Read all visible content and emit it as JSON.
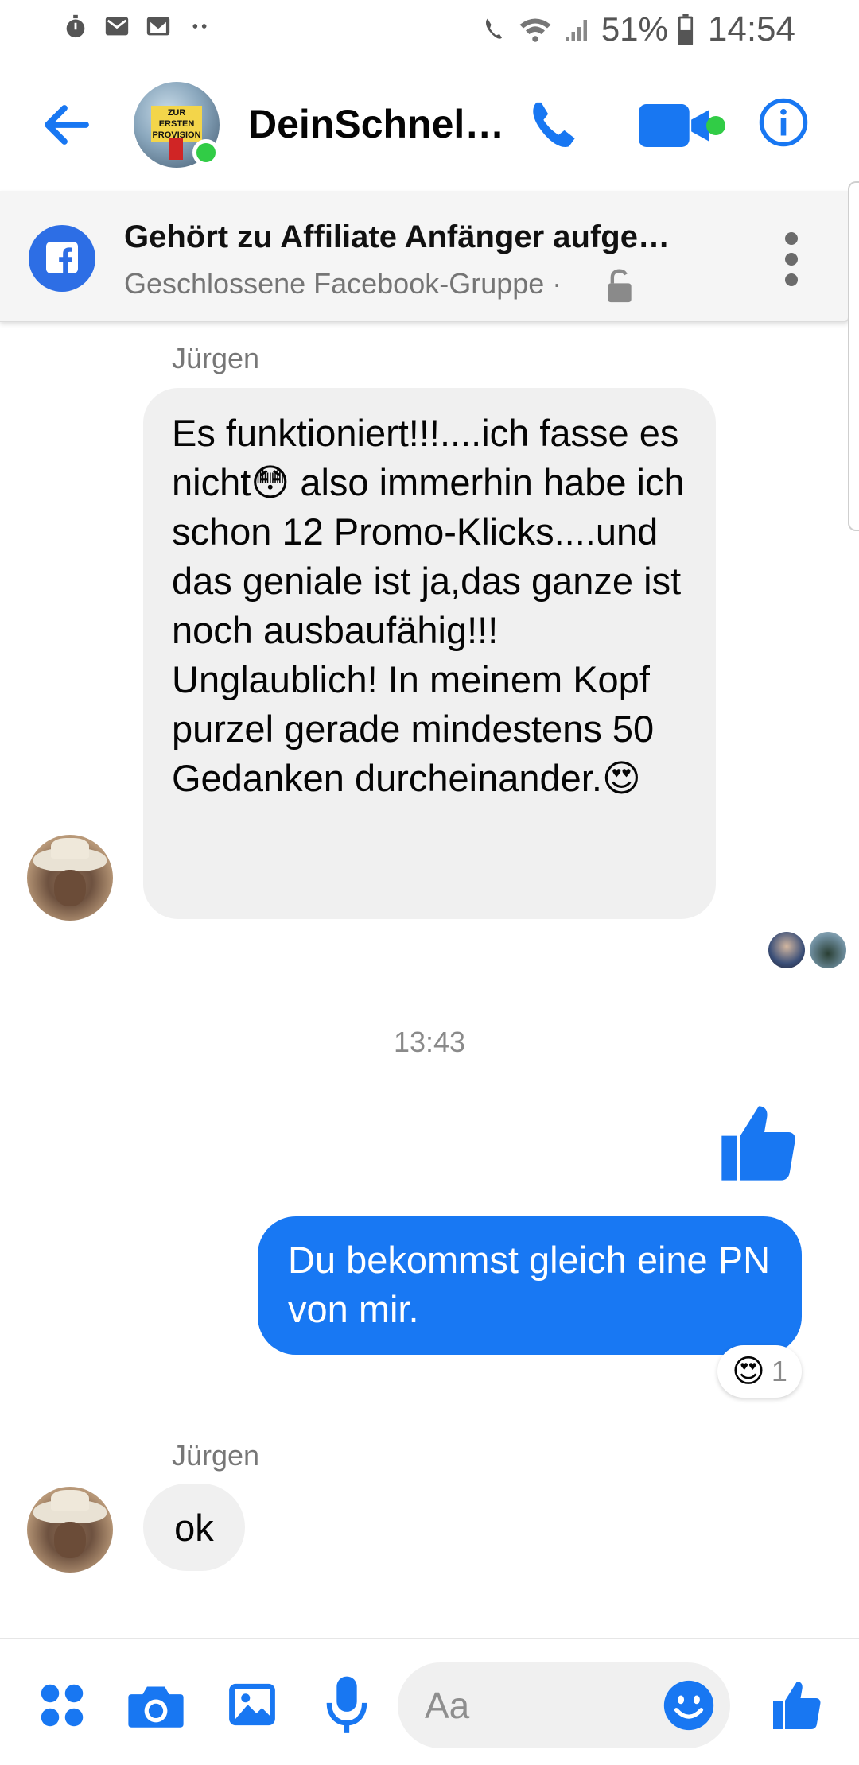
{
  "status_bar": {
    "battery": "51%",
    "time": "14:54"
  },
  "header": {
    "title": "DeinSchnel…",
    "avatar_text": "ZUR ERSTEN PROVISION"
  },
  "group": {
    "title": "Gehört zu Affiliate Anfänger aufge…",
    "subtitle": "Geschlossene Facebook-Gruppe ·"
  },
  "messages": {
    "sender_1": "Jürgen",
    "message_1": "Es funktioniert!!!....ich fasse es nicht😳 also immerhin habe ich schon 12 Promo-Klicks....und das geniale ist ja,das ganze ist noch ausbaufähig!!! Unglaublich! In meinem Kopf purzel gerade mindestens 50 Gedanken durcheinander.😍",
    "timestamp": "13:43",
    "outgoing_1": "Du bekommst gleich eine PN von mir.",
    "reaction_emoji": "😍",
    "reaction_count": "1",
    "sender_2": "Jürgen",
    "message_2": "ok"
  },
  "composer": {
    "placeholder": "Aa"
  },
  "colors": {
    "accent": "#1877f2",
    "online": "#31cc46",
    "bubble_in": "#f0f0f0"
  },
  "icons": [
    "stopwatch-icon",
    "gmail-icon",
    "mail-icon",
    "wifi-icon",
    "signal-icon",
    "battery-icon",
    "back-arrow-icon",
    "phone-icon",
    "video-icon",
    "info-icon",
    "facebook-icon",
    "lock-icon",
    "more-icon",
    "thumbs-up-icon",
    "apps-icon",
    "camera-icon",
    "gallery-icon",
    "mic-icon",
    "emoji-icon"
  ]
}
